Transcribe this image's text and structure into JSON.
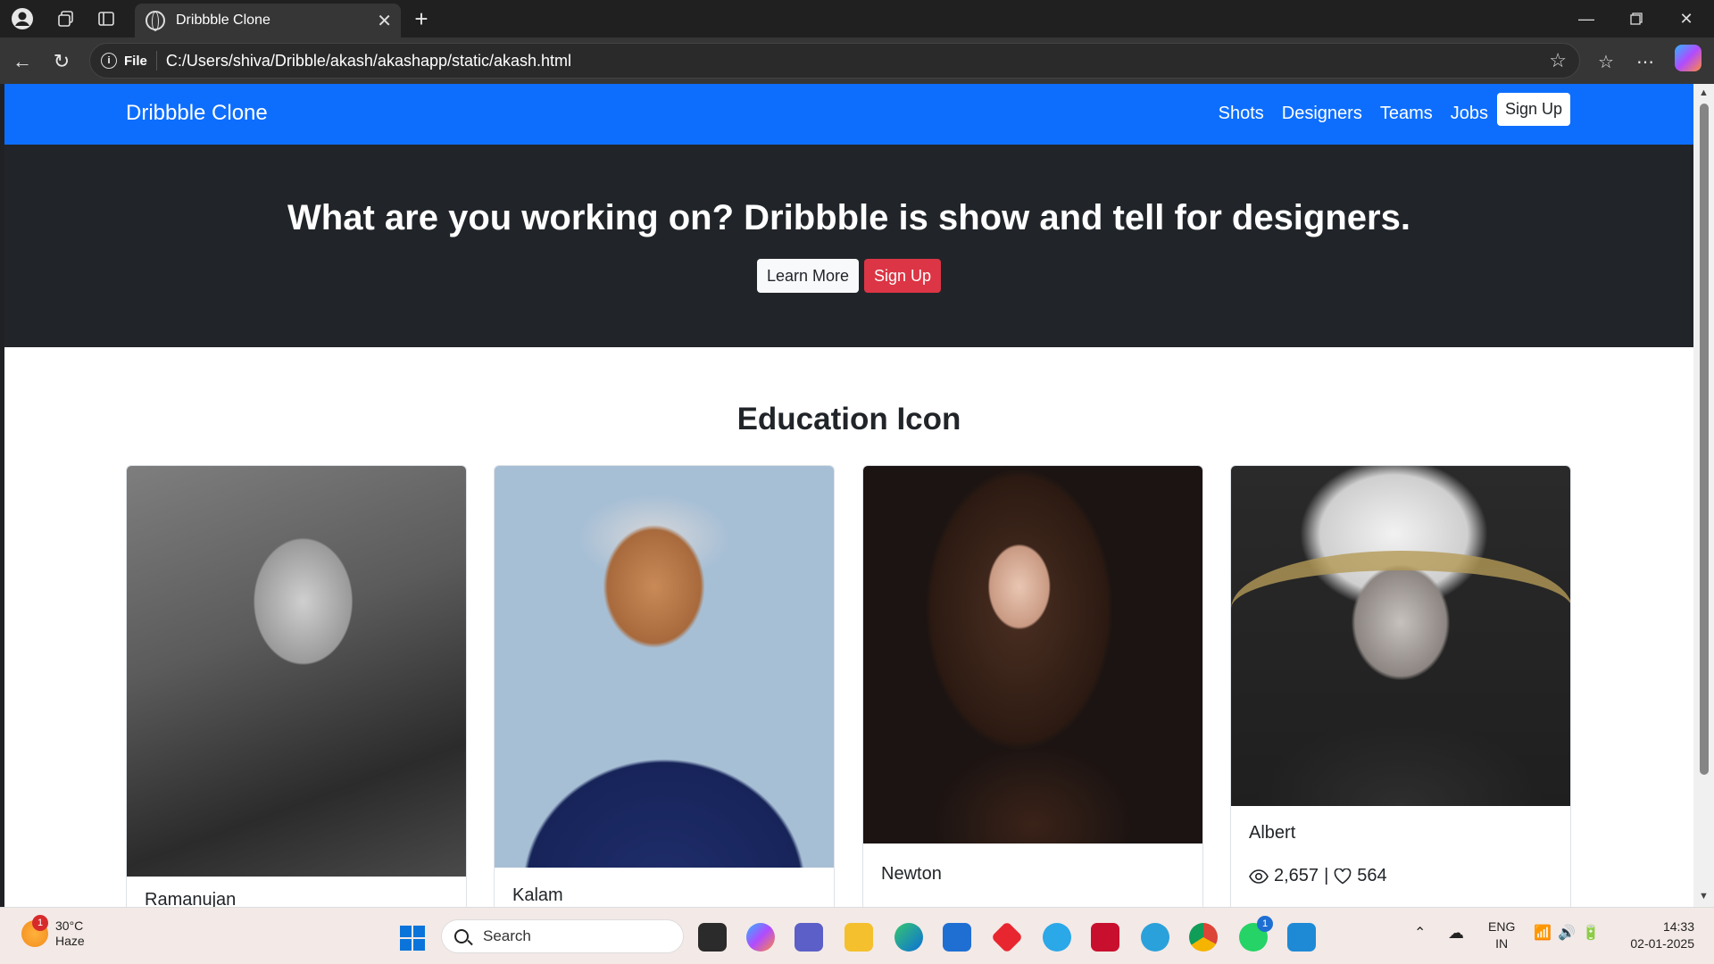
{
  "browser": {
    "tab_title": "Dribbble Clone",
    "address": {
      "scheme_label": "File",
      "url": "C:/Users/shiva/Dribble/akash/akashapp/static/akash.html"
    }
  },
  "page": {
    "navbar": {
      "brand": "Dribbble Clone",
      "links": [
        "Shots",
        "Designers",
        "Teams",
        "Jobs"
      ],
      "signup": "Sign Up"
    },
    "hero": {
      "headline": "What are you working on? Dribbble is show and tell for designers.",
      "learn_more": "Learn More",
      "signup": "Sign Up"
    },
    "section_title": "Education Icon",
    "cards": [
      {
        "name": "Ramanujan"
      },
      {
        "name": "Kalam"
      },
      {
        "name": "Newton"
      },
      {
        "name": "Albert",
        "views": "2,657",
        "separator": "|",
        "likes": "564"
      }
    ]
  },
  "taskbar": {
    "weather": {
      "temp": "30°C",
      "condition": "Haze",
      "badge": "1"
    },
    "search_placeholder": "Search",
    "language": {
      "line1": "ENG",
      "line2": "IN"
    },
    "time": "14:33",
    "date": "02-01-2025",
    "whatsapp_badge": "1"
  }
}
